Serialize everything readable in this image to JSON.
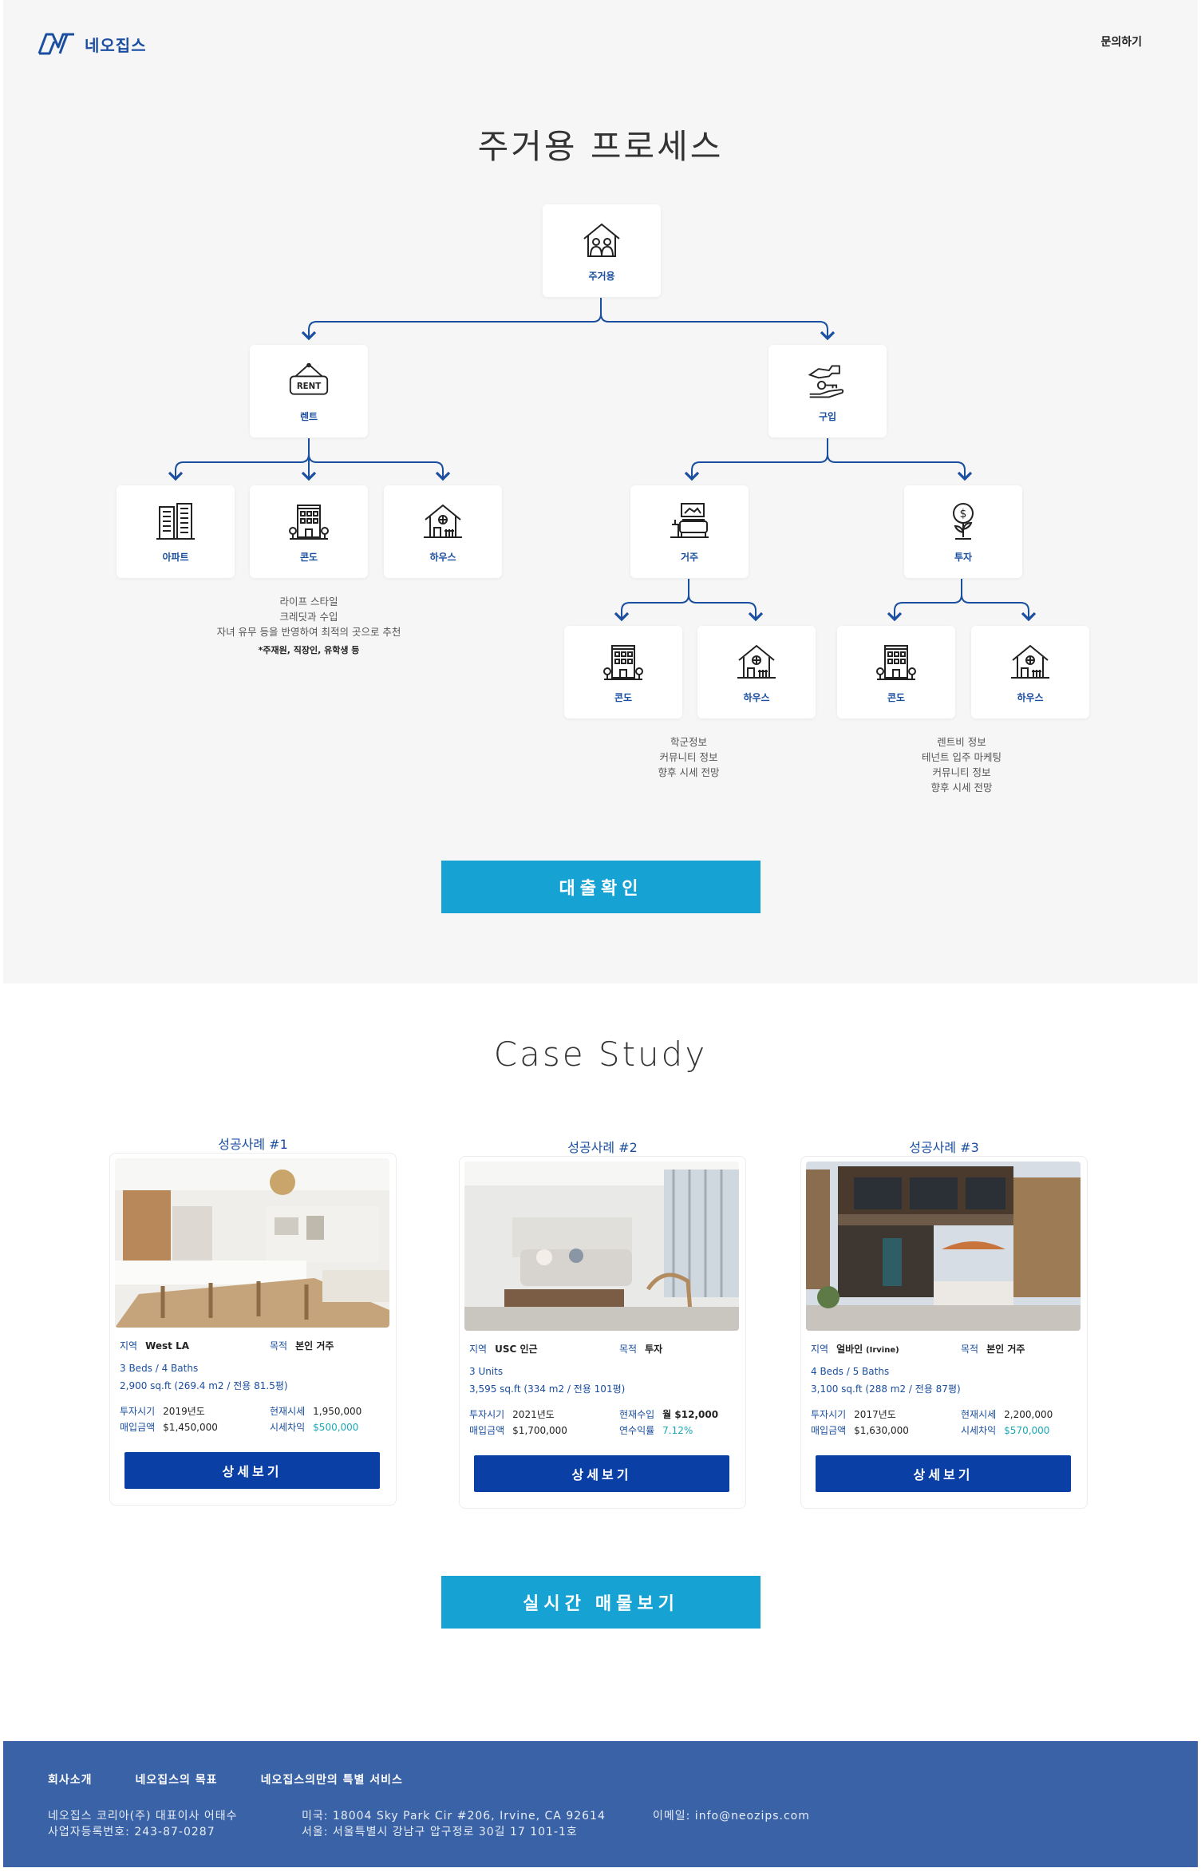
{
  "header": {
    "logo_text": "네오집스",
    "contact_label": "문의하기"
  },
  "process": {
    "title": "주거용 프로세스",
    "root": {
      "label": "주거용",
      "icon": "family-house-icon"
    },
    "rent": {
      "label": "렌트",
      "icon": "rent-sign-icon"
    },
    "buy": {
      "label": "구입",
      "icon": "key-hand-icon"
    },
    "rent_children": [
      {
        "label": "아파트",
        "icon": "apartment-icon"
      },
      {
        "label": "콘도",
        "icon": "condo-icon"
      },
      {
        "label": "하우스",
        "icon": "house-icon"
      }
    ],
    "buy_children": [
      {
        "label": "거주",
        "icon": "living-room-icon"
      },
      {
        "label": "투자",
        "icon": "investment-icon"
      }
    ],
    "live_children": [
      {
        "label": "콘도",
        "icon": "condo-icon"
      },
      {
        "label": "하우스",
        "icon": "house-icon"
      }
    ],
    "invest_children": [
      {
        "label": "콘도",
        "icon": "condo-icon"
      },
      {
        "label": "하우스",
        "icon": "house-icon"
      }
    ],
    "rent_note": {
      "lines": [
        "라이프 스타일",
        "크레딧과 수입",
        "자녀 유무 등을 반영하여 최적의 곳으로 추천"
      ],
      "strong": "*주재원, 직장인, 유학생 등"
    },
    "live_note": {
      "lines": [
        "학군정보",
        "커뮤니티 정보",
        "향후 시세 전망"
      ]
    },
    "invest_note": {
      "lines": [
        "렌트비 정보",
        "테넌트 입주 마케팅",
        "커뮤니티 정보",
        "향후 시세 전망"
      ]
    },
    "loan_button": "대출확인"
  },
  "case_study": {
    "title": "Case Study",
    "detail_button": "상세보기",
    "cases": [
      {
        "label": "성공사례 #1",
        "region_key": "지역",
        "region": "West LA",
        "purpose_key": "목적",
        "purpose": "본인 거주",
        "spec1": "3 Beds / 4 Baths",
        "spec2": "2,900 sq.ft (269.4 m2 / 전용 81.5평)",
        "a_key": "투자시기",
        "a_val": "2019년도",
        "b_key": "현재시세",
        "b_val": "1,950,000",
        "c_key": "매입금액",
        "c_val": "$1,450,000",
        "d_key": "시세차익",
        "d_val": "$500,000"
      },
      {
        "label": "성공사례 #2",
        "region_key": "지역",
        "region": "USC 인근",
        "purpose_key": "목적",
        "purpose": "투자",
        "spec1": "3 Units",
        "spec2": "3,595 sq.ft (334 m2 / 전용 101평)",
        "a_key": "투자시기",
        "a_val": "2021년도",
        "b_key": "현재수입",
        "b_val": "월 $12,000",
        "c_key": "매입금액",
        "c_val": "$1,700,000",
        "d_key": "연수익률",
        "d_val": "7.12%"
      },
      {
        "label": "성공사례 #3",
        "region_key": "지역",
        "region": "얼바인",
        "region_sub": "(Irvine)",
        "purpose_key": "목적",
        "purpose": "본인 거주",
        "spec1": "4 Beds / 5 Baths",
        "spec2": "3,100 sq.ft (288 m2 / 전용 87평)",
        "a_key": "투자시기",
        "a_val": "2017년도",
        "b_key": "현재시세",
        "b_val": "2,200,000",
        "c_key": "매입금액",
        "c_val": "$1,630,000",
        "d_key": "시세차익",
        "d_val": "$570,000"
      }
    ],
    "live_button": "실시간 매물보기"
  },
  "footer": {
    "nav": [
      "회사소개",
      "네오집스의 목표",
      "네오집스의만의 특별 서비스"
    ],
    "company_line1": "네오집스 코리아(주) 대표이사 어태수",
    "company_line2": "사업자등록번호: 243-87-0287",
    "address_us": "미국: 18004 Sky Park Cir #206, Irvine, CA 92614",
    "address_kr": "서울: 서울특별시 강남구 압구정로 30길 17 101-1호",
    "email": "이메일: info@neozips.com"
  },
  "colors": {
    "brand": "#1a4ea0",
    "cta": "#16a3d3",
    "footer": "#3a62a6",
    "button_dark": "#0a3fa6"
  }
}
